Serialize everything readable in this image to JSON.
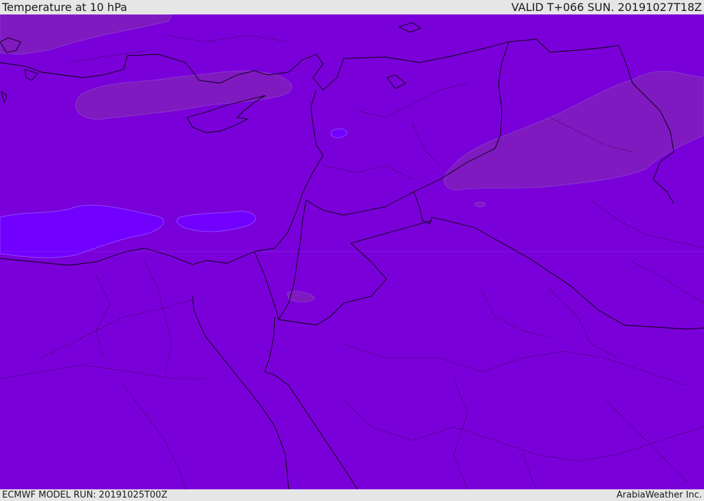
{
  "header": {
    "title": "Temperature at 10 hPa",
    "valid_time": "VALID T+066 SUN. 20191027T18Z"
  },
  "footer": {
    "model_run": "ECMWF MODEL RUN: 20191025T00Z",
    "credit": "ArabiaWeather Inc."
  },
  "colors": {
    "base_fill": "#7a00d9",
    "warm_patch": "#7f1cbf",
    "cold_patch": "#7200ff",
    "border_line": "#000000",
    "chrome_bg": "#e6e6e6",
    "chrome_text": "#1a1a1a"
  }
}
